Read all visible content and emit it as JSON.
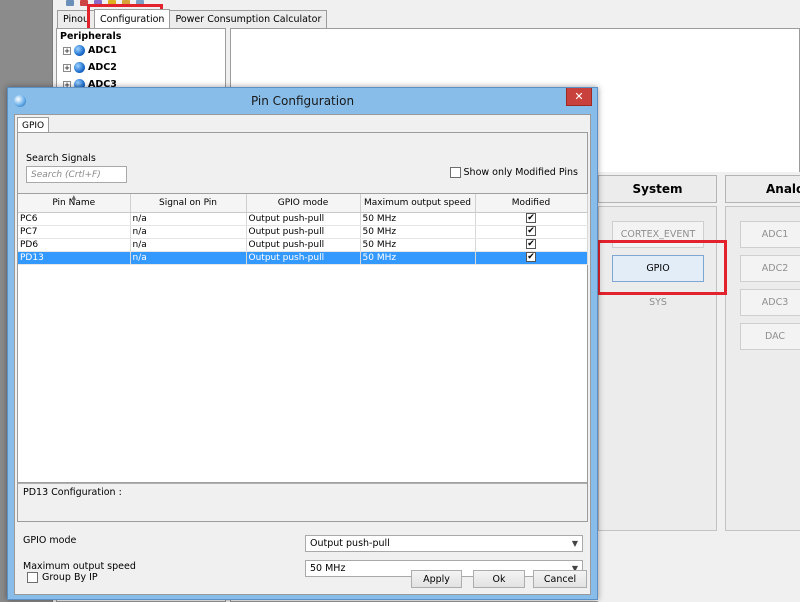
{
  "app": {
    "tabs": [
      {
        "label": "Pinou"
      },
      {
        "label": "Configuration"
      },
      {
        "label": "Power Consumption Calculator"
      }
    ],
    "tree": {
      "title": "Peripherals",
      "items": [
        {
          "label": "ADC1"
        },
        {
          "label": "ADC2"
        },
        {
          "label": "ADC3"
        }
      ]
    },
    "categories": {
      "system": {
        "header": "System",
        "buttons": [
          {
            "label": "CORTEX_EVENT"
          },
          {
            "label": "GPIO"
          },
          {
            "label": "SYS"
          }
        ]
      },
      "analog": {
        "header": "Analog",
        "buttons": [
          {
            "label": "ADC1"
          },
          {
            "label": "ADC2"
          },
          {
            "label": "ADC3"
          },
          {
            "label": "DAC"
          }
        ]
      }
    }
  },
  "dialog": {
    "title": "Pin Configuration",
    "close_glyph": "✕",
    "tab_label": "GPIO",
    "search": {
      "label": "Search Signals",
      "placeholder": "Search (Crtl+F)",
      "value": ""
    },
    "show_only_modified": {
      "label": "Show only Modified Pins",
      "checked": false
    },
    "table": {
      "columns": [
        "Pin Name",
        "Signal on Pin",
        "GPIO mode",
        "Maximum output speed",
        "Modified"
      ],
      "rows": [
        {
          "pin": "PC6",
          "signal": "n/a",
          "mode": "Output push-pull",
          "speed": "50 MHz",
          "modified": true,
          "selected": false
        },
        {
          "pin": "PC7",
          "signal": "n/a",
          "mode": "Output push-pull",
          "speed": "50 MHz",
          "modified": true,
          "selected": false
        },
        {
          "pin": "PD6",
          "signal": "n/a",
          "mode": "Output push-pull",
          "speed": "50 MHz",
          "modified": true,
          "selected": false
        },
        {
          "pin": "PD13",
          "signal": "n/a",
          "mode": "Output push-pull",
          "speed": "50 MHz",
          "modified": true,
          "selected": true
        }
      ]
    },
    "config": {
      "title": "PD13 Configuration :",
      "gpio_mode_label": "GPIO mode",
      "gpio_mode_value": "Output push-pull",
      "speed_label": "Maximum output speed",
      "speed_value": "50 MHz"
    },
    "group_by_ip": {
      "label": "Group By IP",
      "checked": false
    },
    "buttons": {
      "apply": "Apply",
      "ok": "Ok",
      "cancel": "Cancel"
    }
  },
  "colors": {
    "highlight_red": "#e2222c",
    "selection_blue": "#3399ff",
    "titlebar_blue": "#87bde8"
  }
}
